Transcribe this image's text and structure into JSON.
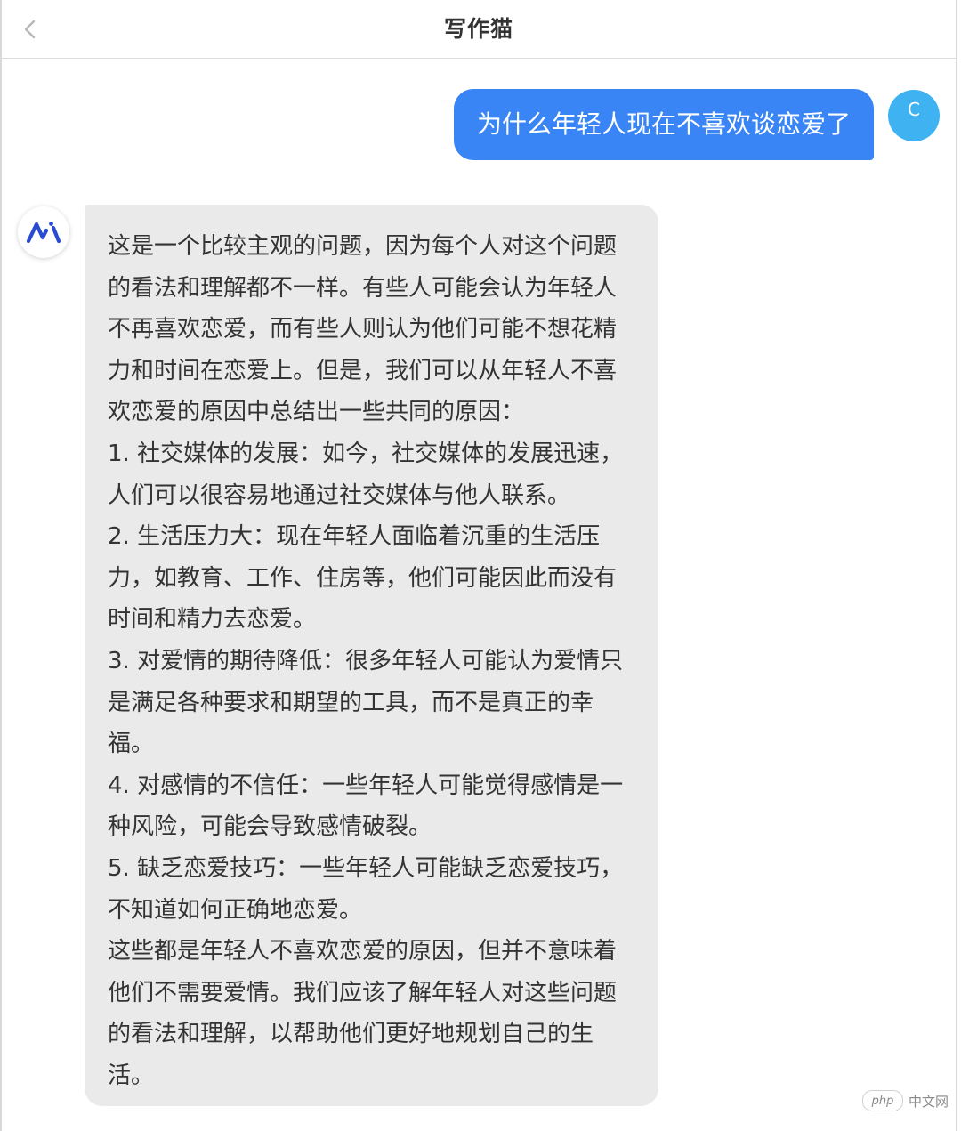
{
  "header": {
    "title": "写作猫",
    "back_icon": "chevron-left-icon"
  },
  "user_message": {
    "text": "为什么年轻人现在不喜欢谈恋爱了",
    "avatar_letter": "C",
    "bubble_color": "#3a85f5",
    "avatar_color": "#3fb3f2"
  },
  "bot_message": {
    "avatar_icon": "ai-logo-icon",
    "bubble_color": "#eaeaea",
    "lines": [
      "这是一个比较主观的问题，因为每个人对这个问题",
      "的看法和理解都不一样。有些人可能会认为年轻人",
      "不再喜欢恋爱，而有些人则认为他们可能不想花精",
      "力和时间在恋爱上。但是，我们可以从年轻人不喜",
      "欢恋爱的原因中总结出一些共同的原因：",
      "1. 社交媒体的发展：如今，社交媒体的发展迅速，",
      "人们可以很容易地通过社交媒体与他人联系。",
      "2. 生活压力大：现在年轻人面临着沉重的生活压",
      "力，如教育、工作、住房等，他们可能因此而没有",
      "时间和精力去恋爱。",
      "3. 对爱情的期待降低：很多年轻人可能认为爱情只",
      "是满足各种要求和期望的工具，而不是真正的幸",
      "福。",
      "4. 对感情的不信任：一些年轻人可能觉得感情是一",
      "种风险，可能会导致感情破裂。",
      "5. 缺乏恋爱技巧：一些年轻人可能缺乏恋爱技巧，",
      "不知道如何正确地恋爱。",
      "这些都是年轻人不喜欢恋爱的原因，但并不意味着",
      "他们不需要爱情。我们应该了解年轻人对这些问题",
      "的看法和理解，以帮助他们更好地规划自己的生",
      "活。"
    ]
  },
  "watermark": {
    "badge": "php",
    "text": "中文网"
  }
}
